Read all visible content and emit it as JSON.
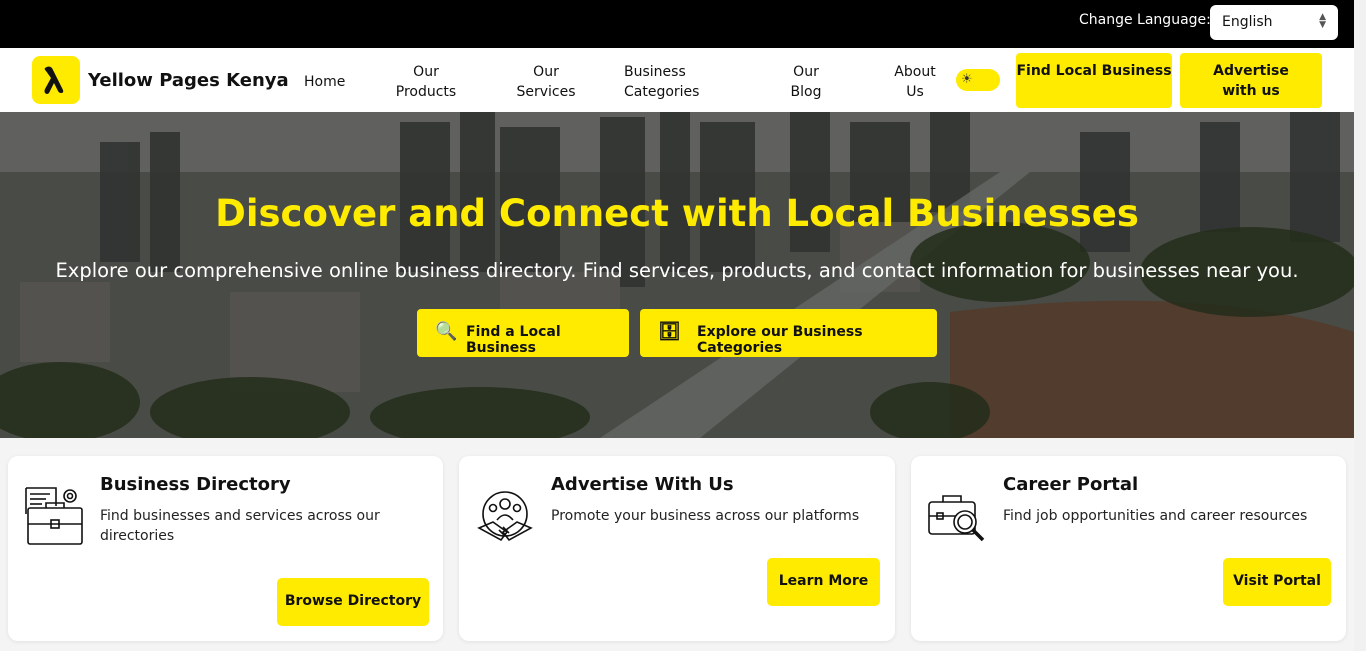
{
  "topbar": {
    "language_label": "Change Language:",
    "language_value": "English"
  },
  "nav": {
    "brand": "Yellow Pages Kenya",
    "links": [
      "Home",
      "Our Products",
      "Our Services",
      "Business Categories",
      "Our Blog",
      "About Us"
    ],
    "find_local_business": "Find Local Business",
    "advertise_with_us": "Advertise with us"
  },
  "hero": {
    "title": "Discover and Connect with Local Businesses",
    "subtitle": "Explore our comprehensive online business directory. Find services, products, and contact information for businesses near you.",
    "btn_find": "Find a Local Business",
    "btn_explore": "Explore our Business Categories"
  },
  "cards": [
    {
      "title": "Business Directory",
      "desc": "Find businesses and services across our directories",
      "button": "Browse Directory",
      "icon": "briefcase-document-icon"
    },
    {
      "title": "Advertise With Us",
      "desc": "Promote your business across our platforms",
      "button": "Learn More",
      "icon": "handshake-team-icon"
    },
    {
      "title": "Career Portal",
      "desc": "Find job opportunities and career resources",
      "button": "Visit Portal",
      "icon": "briefcase-magnifier-icon"
    }
  ],
  "colors": {
    "accent": "#ffeb00",
    "topbar": "#000000"
  }
}
